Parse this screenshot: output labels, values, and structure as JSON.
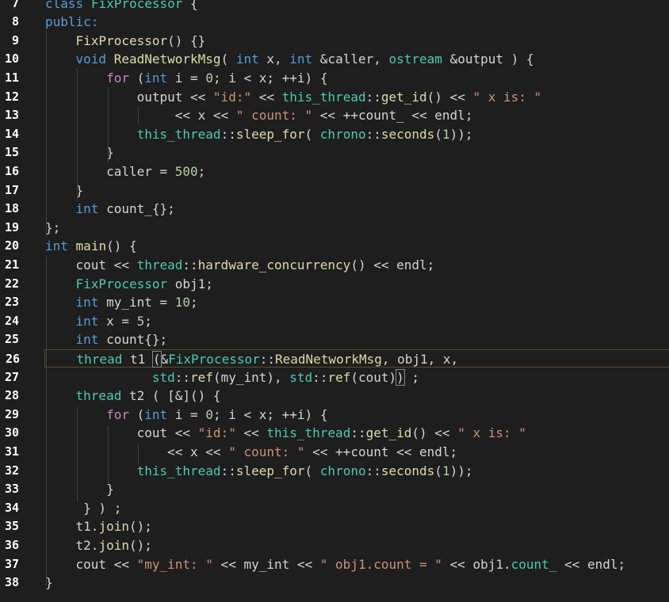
{
  "editor": {
    "colors": {
      "background": "#1e1e1e",
      "keyword": "#569cd6",
      "control": "#c586c0",
      "type": "#4ec9b0",
      "function": "#dcdcaa",
      "string": "#ce9178",
      "number": "#b5cea8",
      "text": "#d4d4d4"
    },
    "current_line": 26,
    "lines": [
      {
        "n": "7",
        "tokens": [
          [
            "kw",
            "class"
          ],
          [
            "",
            " "
          ],
          [
            "ty",
            "FixProcessor"
          ],
          [
            "",
            " {"
          ]
        ]
      },
      {
        "n": "8",
        "tokens": [
          [
            "kw",
            "public:"
          ]
        ]
      },
      {
        "n": "9",
        "tokens": [
          [
            "",
            "    "
          ],
          [
            "fn",
            "FixProcessor"
          ],
          [
            "",
            "() {}"
          ]
        ]
      },
      {
        "n": "10",
        "tokens": [
          [
            "",
            "    "
          ],
          [
            "kw",
            "void"
          ],
          [
            "",
            " "
          ],
          [
            "fn",
            "ReadNetworkMsg"
          ],
          [
            "",
            "( "
          ],
          [
            "kw",
            "int"
          ],
          [
            "",
            " x, "
          ],
          [
            "kw",
            "int"
          ],
          [
            "",
            " &caller, "
          ],
          [
            "ty",
            "ostream"
          ],
          [
            "",
            " &output ) {"
          ]
        ]
      },
      {
        "n": "11",
        "tokens": [
          [
            "",
            "        "
          ],
          [
            "kw2",
            "for"
          ],
          [
            "",
            " ("
          ],
          [
            "kw",
            "int"
          ],
          [
            "",
            " i = "
          ],
          [
            "num",
            "0"
          ],
          [
            "",
            "; i < x; ++i) {"
          ]
        ]
      },
      {
        "n": "12",
        "tokens": [
          [
            "",
            "            output << "
          ],
          [
            "str",
            "\"id:\""
          ],
          [
            "",
            " << "
          ],
          [
            "ty",
            "this_thread"
          ],
          [
            "",
            "::"
          ],
          [
            "fn",
            "get_id"
          ],
          [
            "",
            "() << "
          ],
          [
            "str",
            "\" x is: \""
          ]
        ]
      },
      {
        "n": "13",
        "tokens": [
          [
            "",
            "                 << x << "
          ],
          [
            "str",
            "\" count: \""
          ],
          [
            "",
            " << ++count_ << endl;"
          ]
        ]
      },
      {
        "n": "14",
        "tokens": [
          [
            "",
            "            "
          ],
          [
            "ty",
            "this_thread"
          ],
          [
            "",
            "::"
          ],
          [
            "fn",
            "sleep_for"
          ],
          [
            "",
            "( "
          ],
          [
            "ty",
            "chrono"
          ],
          [
            "",
            "::"
          ],
          [
            "fn",
            "seconds"
          ],
          [
            "",
            "("
          ],
          [
            "num",
            "1"
          ],
          [
            "",
            "));"
          ]
        ]
      },
      {
        "n": "15",
        "tokens": [
          [
            "",
            "        }"
          ]
        ]
      },
      {
        "n": "16",
        "tokens": [
          [
            "",
            "        caller = "
          ],
          [
            "num",
            "500"
          ],
          [
            "",
            ";"
          ]
        ]
      },
      {
        "n": "17",
        "tokens": [
          [
            "",
            "    }"
          ]
        ]
      },
      {
        "n": "18",
        "tokens": [
          [
            "",
            "    "
          ],
          [
            "kw",
            "int"
          ],
          [
            "",
            " count_{};"
          ]
        ]
      },
      {
        "n": "19",
        "tokens": [
          [
            "",
            "};"
          ]
        ]
      },
      {
        "n": "20",
        "tokens": [
          [
            "kw",
            "int"
          ],
          [
            "",
            " "
          ],
          [
            "fn",
            "main"
          ],
          [
            "",
            "() {"
          ]
        ]
      },
      {
        "n": "21",
        "tokens": [
          [
            "",
            "    cout << "
          ],
          [
            "ty",
            "thread"
          ],
          [
            "",
            "::"
          ],
          [
            "fn",
            "hardware_concurrency"
          ],
          [
            "",
            "() << endl;"
          ]
        ]
      },
      {
        "n": "22",
        "tokens": [
          [
            "",
            "    "
          ],
          [
            "ty",
            "FixProcessor"
          ],
          [
            "",
            " obj1;"
          ]
        ]
      },
      {
        "n": "23",
        "tokens": [
          [
            "",
            "    "
          ],
          [
            "kw",
            "int"
          ],
          [
            "",
            " my_int = "
          ],
          [
            "num",
            "10"
          ],
          [
            "",
            ";"
          ]
        ]
      },
      {
        "n": "24",
        "tokens": [
          [
            "",
            "    "
          ],
          [
            "kw",
            "int"
          ],
          [
            "",
            " x = "
          ],
          [
            "num",
            "5"
          ],
          [
            "",
            ";"
          ]
        ]
      },
      {
        "n": "25",
        "tokens": [
          [
            "",
            "    "
          ],
          [
            "kw",
            "int"
          ],
          [
            "",
            " count{};"
          ]
        ]
      },
      {
        "n": "26",
        "tokens": [
          [
            "",
            "    "
          ],
          [
            "ty",
            "thread"
          ],
          [
            "",
            " t1 "
          ],
          [
            "bm",
            "("
          ],
          [
            "",
            "&"
          ],
          [
            "ty",
            "FixProcessor"
          ],
          [
            "",
            "::"
          ],
          [
            "fn",
            "ReadNetworkMsg"
          ],
          [
            "",
            ", obj1, x,"
          ]
        ]
      },
      {
        "n": "27",
        "tokens": [
          [
            "",
            "              "
          ],
          [
            "ty",
            "std"
          ],
          [
            "",
            "::"
          ],
          [
            "fn",
            "ref"
          ],
          [
            "",
            "(my_int), "
          ],
          [
            "ty",
            "std"
          ],
          [
            "",
            "::"
          ],
          [
            "fn",
            "ref"
          ],
          [
            "",
            "(cout)"
          ],
          [
            "bm",
            ")"
          ],
          [
            "",
            " ;"
          ]
        ]
      },
      {
        "n": "28",
        "tokens": [
          [
            "",
            "    "
          ],
          [
            "ty",
            "thread"
          ],
          [
            "",
            " t2 ( [&]() {"
          ]
        ]
      },
      {
        "n": "29",
        "tokens": [
          [
            "",
            "        "
          ],
          [
            "kw2",
            "for"
          ],
          [
            "",
            " ("
          ],
          [
            "kw",
            "int"
          ],
          [
            "",
            " i = "
          ],
          [
            "num",
            "0"
          ],
          [
            "",
            "; i < x; ++i) {"
          ]
        ]
      },
      {
        "n": "30",
        "tokens": [
          [
            "",
            "            cout << "
          ],
          [
            "str",
            "\"id:\""
          ],
          [
            "",
            " << "
          ],
          [
            "ty",
            "this_thread"
          ],
          [
            "",
            "::"
          ],
          [
            "fn",
            "get_id"
          ],
          [
            "",
            "() << "
          ],
          [
            "str",
            "\" x is: \""
          ]
        ]
      },
      {
        "n": "31",
        "tokens": [
          [
            "",
            "                << x << "
          ],
          [
            "str",
            "\" count: \""
          ],
          [
            "",
            " << ++count << endl;"
          ]
        ]
      },
      {
        "n": "32",
        "tokens": [
          [
            "",
            "            "
          ],
          [
            "ty",
            "this_thread"
          ],
          [
            "",
            "::"
          ],
          [
            "fn",
            "sleep_for"
          ],
          [
            "",
            "( "
          ],
          [
            "ty",
            "chrono"
          ],
          [
            "",
            "::"
          ],
          [
            "fn",
            "seconds"
          ],
          [
            "",
            "("
          ],
          [
            "num",
            "1"
          ],
          [
            "",
            "));"
          ]
        ]
      },
      {
        "n": "33",
        "tokens": [
          [
            "",
            "        }"
          ]
        ]
      },
      {
        "n": "34",
        "tokens": [
          [
            "",
            "     } ) ;"
          ]
        ]
      },
      {
        "n": "35",
        "tokens": [
          [
            "",
            "    t1."
          ],
          [
            "fn",
            "join"
          ],
          [
            "",
            "();"
          ]
        ]
      },
      {
        "n": "36",
        "tokens": [
          [
            "",
            "    t2."
          ],
          [
            "fn",
            "join"
          ],
          [
            "",
            "();"
          ]
        ]
      },
      {
        "n": "37",
        "tokens": [
          [
            "",
            "    cout << "
          ],
          [
            "str",
            "\"my_int: \""
          ],
          [
            "",
            " << my_int << "
          ],
          [
            "str",
            "\" obj1.count = \""
          ],
          [
            "",
            " << obj1."
          ],
          [
            "ty",
            "count_"
          ],
          [
            "",
            " << endl;"
          ]
        ]
      },
      {
        "n": "38",
        "tokens": [
          [
            "",
            "}"
          ]
        ]
      }
    ]
  }
}
